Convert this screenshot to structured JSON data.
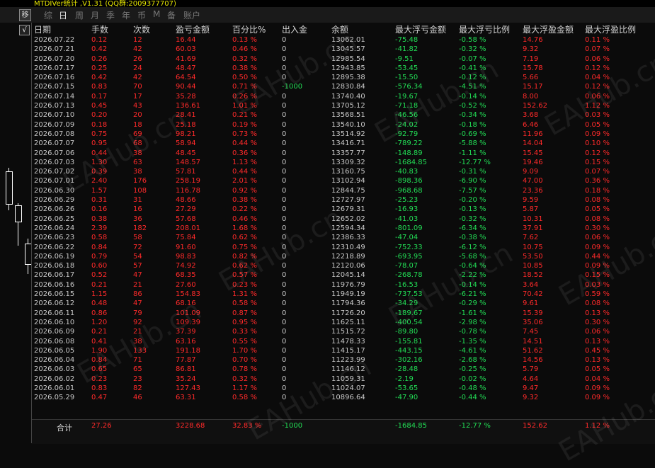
{
  "window": {
    "title": "MTDIVer统计 ,V1.31 (QQ群:2009377707)"
  },
  "tabs": [
    "综",
    "日",
    "周",
    "月",
    "季",
    "年",
    "币",
    "M",
    "备",
    "账户"
  ],
  "active_tab": "日",
  "logo_text": "移",
  "check_mark": "√",
  "columns": [
    "日期",
    "手数",
    "次数",
    "盈亏金额",
    "百分比%",
    "出入金",
    "余额",
    "最大浮亏金额",
    "最大浮亏比例",
    "最大浮盈金额",
    "最大浮盈比例"
  ],
  "rows": [
    [
      "2026.07.22",
      "0.12",
      "12",
      "16.44",
      "0.13 %",
      "0",
      "13062.01",
      "-75.48",
      "-0.58 %",
      "14.76",
      "0.11 %"
    ],
    [
      "2026.07.21",
      "0.42",
      "42",
      "60.03",
      "0.46 %",
      "0",
      "13045.57",
      "-41.82",
      "-0.32 %",
      "9.32",
      "0.07 %"
    ],
    [
      "2026.07.20",
      "0.26",
      "26",
      "41.69",
      "0.32 %",
      "0",
      "12985.54",
      "-9.51",
      "-0.07 %",
      "7.19",
      "0.06 %"
    ],
    [
      "2026.07.17",
      "0.25",
      "24",
      "48.47",
      "0.38 %",
      "0",
      "12943.85",
      "-53.45",
      "-0.41 %",
      "15.78",
      "0.12 %"
    ],
    [
      "2026.07.16",
      "0.42",
      "42",
      "64.54",
      "0.50 %",
      "0",
      "12895.38",
      "-15.50",
      "-0.12 %",
      "5.66",
      "0.04 %"
    ],
    [
      "2026.07.15",
      "0.83",
      "70",
      "90.44",
      "0.71 %",
      "-1000",
      "12830.84",
      "-576.34",
      "-4.51 %",
      "15.17",
      "0.12 %"
    ],
    [
      "2026.07.14",
      "0.17",
      "17",
      "35.28",
      "0.26 %",
      "0",
      "13740.40",
      "-19.67",
      "-0.14 %",
      "8.00",
      "0.06 %"
    ],
    [
      "2026.07.13",
      "0.45",
      "43",
      "136.61",
      "1.01 %",
      "0",
      "13705.12",
      "-71.18",
      "-0.52 %",
      "152.62",
      "1.12 %"
    ],
    [
      "2026.07.10",
      "0.20",
      "20",
      "28.41",
      "0.21 %",
      "0",
      "13568.51",
      "-46.56",
      "-0.34 %",
      "3.68",
      "0.03 %"
    ],
    [
      "2026.07.09",
      "0.18",
      "18",
      "25.18",
      "0.19 %",
      "0",
      "13540.10",
      "-24.02",
      "-0.18 %",
      "6.46",
      "0.05 %"
    ],
    [
      "2026.07.08",
      "0.75",
      "69",
      "98.21",
      "0.73 %",
      "0",
      "13514.92",
      "-92.79",
      "-0.69 %",
      "11.96",
      "0.09 %"
    ],
    [
      "2026.07.07",
      "0.95",
      "68",
      "58.94",
      "0.44 %",
      "0",
      "13416.71",
      "-789.22",
      "-5.88 %",
      "14.04",
      "0.10 %"
    ],
    [
      "2026.07.06",
      "0.44",
      "38",
      "48.45",
      "0.36 %",
      "0",
      "13357.77",
      "-148.89",
      "-1.11 %",
      "15.45",
      "0.12 %"
    ],
    [
      "2026.07.03",
      "1.30",
      "63",
      "148.57",
      "1.13 %",
      "0",
      "13309.32",
      "-1684.85",
      "-12.77 %",
      "19.46",
      "0.15 %"
    ],
    [
      "2026.07.02",
      "0.39",
      "38",
      "57.81",
      "0.44 %",
      "0",
      "13160.75",
      "-40.83",
      "-0.31 %",
      "9.09",
      "0.07 %"
    ],
    [
      "2026.07.01",
      "2.40",
      "176",
      "258.19",
      "2.01 %",
      "0",
      "13102.94",
      "-898.36",
      "-6.90 %",
      "47.00",
      "0.36 %"
    ],
    [
      "2026.06.30",
      "1.57",
      "108",
      "116.78",
      "0.92 %",
      "0",
      "12844.75",
      "-968.68",
      "-7.57 %",
      "23.36",
      "0.18 %"
    ],
    [
      "2026.06.29",
      "0.31",
      "31",
      "48.66",
      "0.38 %",
      "0",
      "12727.97",
      "-25.23",
      "-0.20 %",
      "9.59",
      "0.08 %"
    ],
    [
      "2026.06.26",
      "0.16",
      "16",
      "27.29",
      "0.22 %",
      "0",
      "12679.31",
      "-16.93",
      "-0.13 %",
      "5.87",
      "0.05 %"
    ],
    [
      "2026.06.25",
      "0.38",
      "36",
      "57.68",
      "0.46 %",
      "0",
      "12652.02",
      "-41.03",
      "-0.32 %",
      "10.31",
      "0.08 %"
    ],
    [
      "2026.06.24",
      "2.39",
      "182",
      "208.01",
      "1.68 %",
      "0",
      "12594.34",
      "-801.09",
      "-6.34 %",
      "37.91",
      "0.30 %"
    ],
    [
      "2026.06.23",
      "0.58",
      "58",
      "75.84",
      "0.62 %",
      "0",
      "12386.33",
      "-47.04",
      "-0.38 %",
      "7.62",
      "0.06 %"
    ],
    [
      "2026.06.22",
      "0.84",
      "72",
      "91.60",
      "0.75 %",
      "0",
      "12310.49",
      "-752.33",
      "-6.12 %",
      "10.75",
      "0.09 %"
    ],
    [
      "2026.06.19",
      "0.79",
      "54",
      "98.83",
      "0.82 %",
      "0",
      "12218.89",
      "-693.95",
      "-5.68 %",
      "53.50",
      "0.44 %"
    ],
    [
      "2026.06.18",
      "0.60",
      "57",
      "74.92",
      "0.62 %",
      "0",
      "12120.06",
      "-78.07",
      "-0.64 %",
      "10.85",
      "0.09 %"
    ],
    [
      "2026.06.17",
      "0.52",
      "47",
      "68.35",
      "0.57 %",
      "0",
      "12045.14",
      "-268.78",
      "-2.22 %",
      "18.52",
      "0.15 %"
    ],
    [
      "2026.06.16",
      "0.21",
      "21",
      "27.60",
      "0.23 %",
      "0",
      "11976.79",
      "-16.53",
      "-0.14 %",
      "3.64",
      "0.03 %"
    ],
    [
      "2026.06.15",
      "1.15",
      "86",
      "154.83",
      "1.31 %",
      "0",
      "11949.19",
      "-737.53",
      "-6.21 %",
      "70.42",
      "0.59 %"
    ],
    [
      "2026.06.12",
      "0.48",
      "47",
      "68.16",
      "0.58 %",
      "0",
      "11794.36",
      "-34.29",
      "-0.29 %",
      "9.61",
      "0.08 %"
    ],
    [
      "2026.06.11",
      "0.86",
      "79",
      "101.09",
      "0.87 %",
      "0",
      "11726.20",
      "-189.67",
      "-1.61 %",
      "15.39",
      "0.13 %"
    ],
    [
      "2026.06.10",
      "1.20",
      "92",
      "109.39",
      "0.95 %",
      "0",
      "11625.11",
      "-400.54",
      "-2.98 %",
      "35.06",
      "0.30 %"
    ],
    [
      "2026.06.09",
      "0.21",
      "21",
      "37.39",
      "0.33 %",
      "0",
      "11515.72",
      "-89.80",
      "-0.78 %",
      "7.45",
      "0.06 %"
    ],
    [
      "2026.06.08",
      "0.41",
      "38",
      "63.16",
      "0.55 %",
      "0",
      "11478.33",
      "-155.81",
      "-1.35 %",
      "14.51",
      "0.13 %"
    ],
    [
      "2026.06.05",
      "1.90",
      "133",
      "191.18",
      "1.70 %",
      "0",
      "11415.17",
      "-443.15",
      "-4.61 %",
      "51.62",
      "0.45 %"
    ],
    [
      "2026.06.04",
      "0.84",
      "71",
      "77.87",
      "0.70 %",
      "0",
      "11223.99",
      "-302.16",
      "-2.68 %",
      "14.56",
      "0.13 %"
    ],
    [
      "2026.06.03",
      "0.65",
      "65",
      "86.81",
      "0.78 %",
      "0",
      "11146.12",
      "-28.48",
      "-0.25 %",
      "5.79",
      "0.05 %"
    ],
    [
      "2026.06.02",
      "0.23",
      "23",
      "35.24",
      "0.32 %",
      "0",
      "11059.31",
      "-2.19",
      "-0.02 %",
      "4.64",
      "0.04 %"
    ],
    [
      "2026.06.01",
      "0.83",
      "82",
      "127.43",
      "1.17 %",
      "0",
      "11024.07",
      "-53.65",
      "-0.48 %",
      "9.47",
      "0.09 %"
    ],
    [
      "2026.05.29",
      "0.47",
      "46",
      "63.31",
      "0.58 %",
      "0",
      "10896.64",
      "-47.90",
      "-0.44 %",
      "9.32",
      "0.09 %"
    ]
  ],
  "summary": {
    "label": "合计",
    "lots": "27.26",
    "count": "",
    "profit": "3228.68",
    "percent": "32.83 %",
    "deposit": "-1000",
    "balance": "",
    "max_float_loss": "-1684.85",
    "max_float_loss_pct": "-12.77 %",
    "max_float_profit": "152.62",
    "max_float_profit_pct": "1.12 %"
  },
  "watermark": "EAHub.cn",
  "colors": {
    "positive": "#ff2a2a",
    "negative": "#22dd55",
    "neutral": "#c8c8c8",
    "title": "#e6e600"
  }
}
